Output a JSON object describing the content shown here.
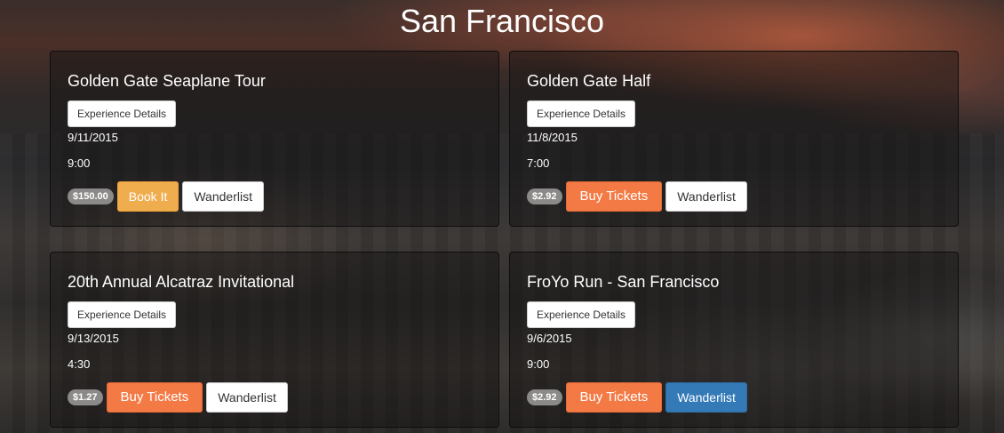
{
  "page": {
    "title": "San Francisco"
  },
  "events": [
    {
      "title": "Golden Gate Seaplane Tour",
      "details_label": "Experience Details",
      "date": "9/11/2015",
      "time": "9:00",
      "price": "$150.00",
      "cta": "Book It",
      "cta_type": "book",
      "wanderlist_label": "Wanderlist",
      "wanderlist_active": false
    },
    {
      "title": "Golden Gate Half",
      "details_label": "Experience Details",
      "date": "11/8/2015",
      "time": "7:00",
      "price": "$2.92",
      "cta": "Buy Tickets",
      "cta_type": "buy",
      "wanderlist_label": "Wanderlist",
      "wanderlist_active": false
    },
    {
      "title": "20th Annual Alcatraz Invitational",
      "details_label": "Experience Details",
      "date": "9/13/2015",
      "time": "4:30",
      "price": "$1.27",
      "cta": "Buy Tickets",
      "cta_type": "buy",
      "wanderlist_label": "Wanderlist",
      "wanderlist_active": false
    },
    {
      "title": "FroYo Run - San Francisco",
      "details_label": "Experience Details",
      "date": "9/6/2015",
      "time": "9:00",
      "price": "$2.92",
      "cta": "Buy Tickets",
      "cta_type": "buy",
      "wanderlist_label": "Wanderlist",
      "wanderlist_active": true
    }
  ],
  "colors": {
    "book": "#f0ad4e",
    "buy": "#f47a45",
    "wanderlist_active": "#337ab7"
  }
}
